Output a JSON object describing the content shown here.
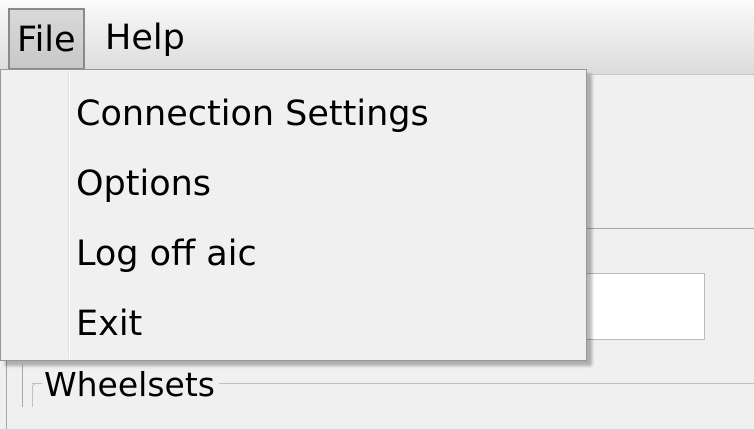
{
  "menubar": {
    "items": [
      {
        "label": "File",
        "active": true
      },
      {
        "label": "Help",
        "active": false
      }
    ]
  },
  "file_menu": {
    "items": [
      {
        "label": "Connection Settings"
      },
      {
        "label": "Options"
      },
      {
        "label": "Log off aic"
      },
      {
        "label": "Exit"
      }
    ]
  },
  "background": {
    "groupbox_label": "Wheelsets",
    "textbox_value": ""
  }
}
